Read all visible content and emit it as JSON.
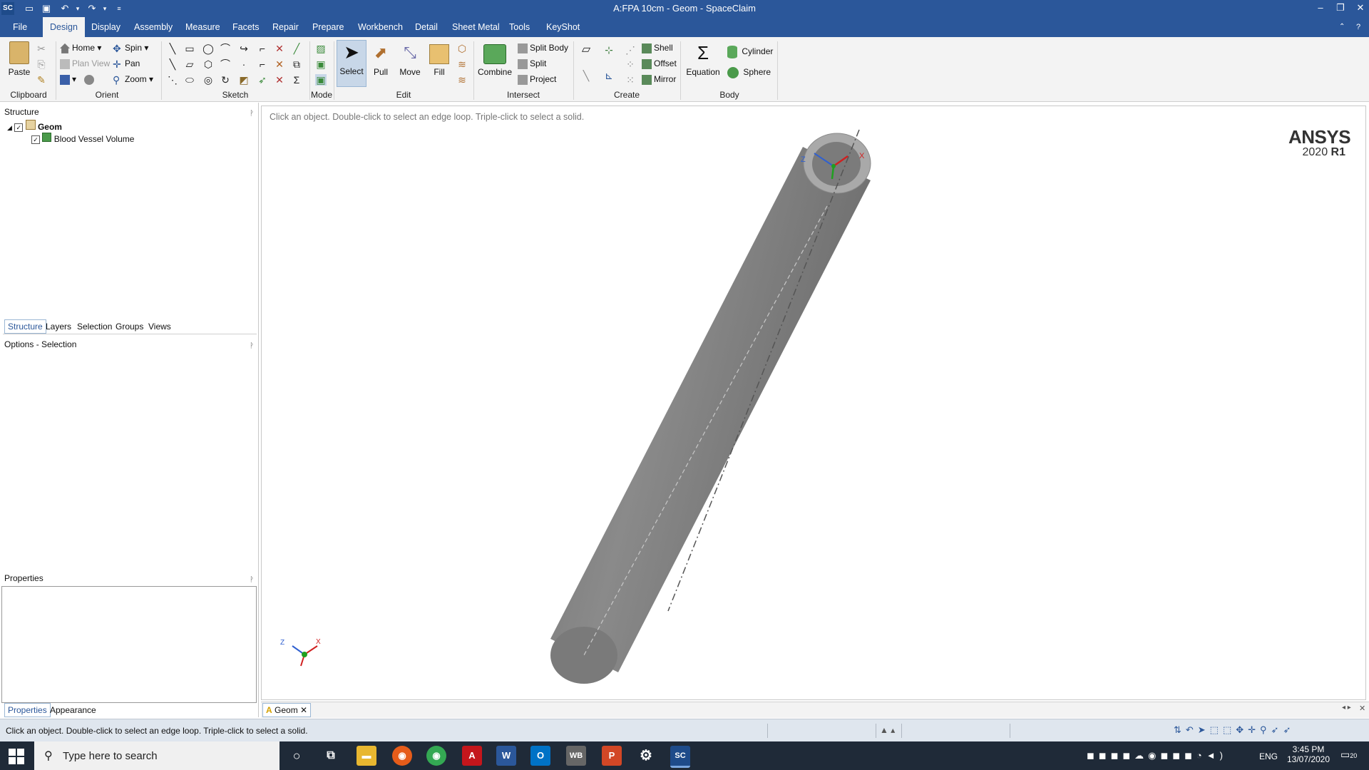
{
  "window": {
    "title": "A:FPA 10cm - Geom - SpaceClaim",
    "app_icon": "SC"
  },
  "menu_tabs": [
    "File",
    "Design",
    "Display",
    "Assembly",
    "Measure",
    "Facets",
    "Repair",
    "Prepare",
    "Workbench",
    "Detail",
    "Sheet Metal",
    "Tools",
    "KeyShot"
  ],
  "active_tab": "Design",
  "ribbon": {
    "paste": "Paste",
    "home": "Home",
    "plan_view": "Plan View",
    "spin": "Spin",
    "pan": "Pan",
    "zoom": "Zoom",
    "select": "Select",
    "pull": "Pull",
    "move": "Move",
    "fill": "Fill",
    "combine": "Combine",
    "split_body": "Split Body",
    "split": "Split",
    "project": "Project",
    "shell": "Shell",
    "offset": "Offset",
    "mirror": "Mirror",
    "equation": "Equation",
    "cylinder": "Cylinder",
    "sphere": "Sphere",
    "groups": {
      "clipboard": "Clipboard",
      "orient": "Orient",
      "sketch": "Sketch",
      "mode": "Mode",
      "edit": "Edit",
      "intersect": "Intersect",
      "create": "Create",
      "body": "Body"
    }
  },
  "structure": {
    "header": "Structure",
    "root": "Geom",
    "child": "Blood Vessel Volume",
    "tabs": [
      "Structure",
      "Layers",
      "Selection",
      "Groups",
      "Views"
    ]
  },
  "options": {
    "header": "Options - Selection"
  },
  "properties": {
    "header": "Properties",
    "tabs": [
      "Properties",
      "Appearance"
    ]
  },
  "viewport": {
    "hint": "Click an object. Double-click to select an edge loop. Triple-click to select a solid.",
    "brand": "ANSYS",
    "version": "2020",
    "release": "R1",
    "axis_x": "X",
    "axis_z": "Z"
  },
  "doc_tab": {
    "label": "Geom"
  },
  "status": {
    "text": "Click an object. Double-click to select an edge loop. Triple-click to select a solid."
  },
  "taskbar": {
    "search_placeholder": "Type here to search",
    "lang": "ENG",
    "time": "3:45 PM",
    "date": "13/07/2020",
    "notif": "20"
  },
  "colors": {
    "titlebar": "#2b579a",
    "ribbon": "#f3f3f3",
    "taskbar": "#1f2a38",
    "cylinder": "#7e7e7e"
  }
}
